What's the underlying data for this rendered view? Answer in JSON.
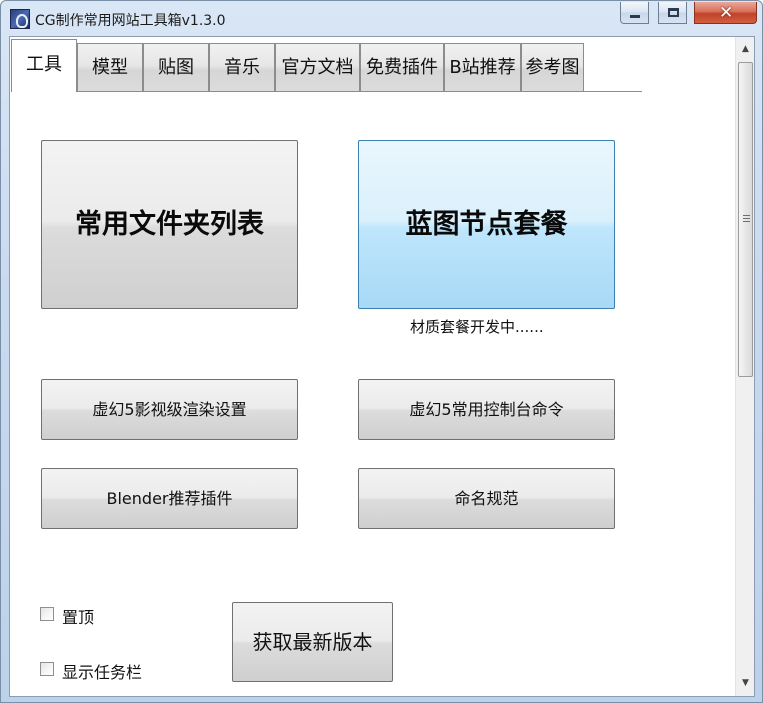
{
  "window": {
    "title": "CG制作常用网站工具箱v1.3.0",
    "minimize_icon": "minimize-icon",
    "maximize_icon": "maximize-icon",
    "close_icon": "close-icon",
    "close_glyph": "✕"
  },
  "tabs": [
    {
      "label": "工具",
      "active": true
    },
    {
      "label": "模型",
      "active": false
    },
    {
      "label": "贴图",
      "active": false
    },
    {
      "label": "音乐",
      "active": false
    },
    {
      "label": "官方文档",
      "active": false
    },
    {
      "label": "免费插件",
      "active": false
    },
    {
      "label": "B站推荐",
      "active": false
    },
    {
      "label": "参考图",
      "active": false
    }
  ],
  "main": {
    "folder_list_button": "常用文件夹列表",
    "blueprint_button": "蓝图节点套餐",
    "material_note": "材质套餐开发中......",
    "ue5_render_button": "虚幻5影视级渲染设置",
    "ue5_console_button": "虚幻5常用控制台命令",
    "blender_plugins_button": "Blender推荐插件",
    "naming_button": "命名规范",
    "update_button": "获取最新版本"
  },
  "options": {
    "pin_top": {
      "label": "置顶",
      "checked": false
    },
    "show_taskbar": {
      "label": "显示任务栏",
      "checked": false
    }
  },
  "colors": {
    "accent_blue": "#bee6fd",
    "close_red": "#c1432a"
  }
}
